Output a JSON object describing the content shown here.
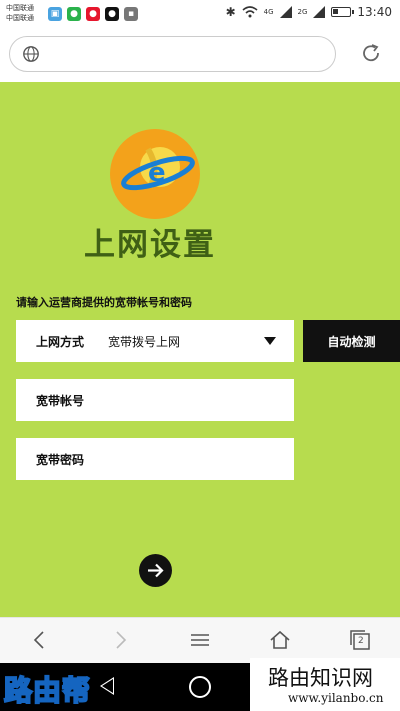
{
  "status_bar": {
    "carrier_line1": "中国联通",
    "carrier_line2": "中国联通",
    "net1": "4G",
    "net2": "2G",
    "time": "13:40"
  },
  "browser": {
    "url": "",
    "reload_icon": "reload-icon"
  },
  "page": {
    "title": "上网设置",
    "hint": "请输入运营商提供的宽带帐号和密码",
    "mode_label": "上网方式",
    "mode_value": "宽带拨号上网",
    "detect_button": "自动检测",
    "account_label": "宽带帐号",
    "password_label": "宽带密码",
    "bg_color": "#b7dc4e"
  },
  "navbar": {
    "tabs_count": "2"
  },
  "watermarks": {
    "left": "路由帮",
    "right_title": "路由知识网",
    "right_url": "www.yilanbo.cn"
  }
}
